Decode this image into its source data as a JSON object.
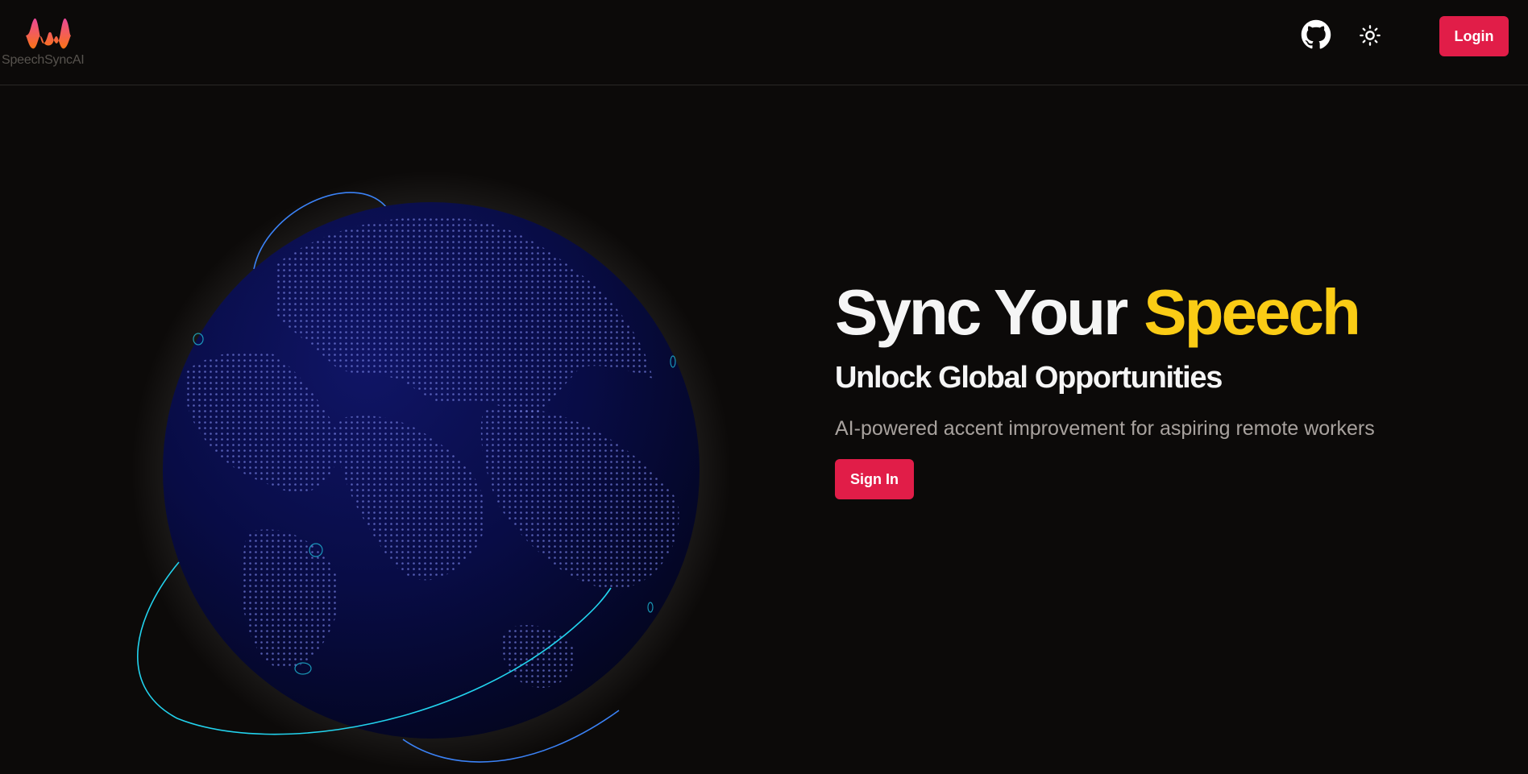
{
  "brand": {
    "name": "SpeechSyncAI",
    "logo_icon": "waveform-logo-icon",
    "gradient": [
      "#ec4899",
      "#f97316"
    ]
  },
  "header": {
    "github_icon": "github-icon",
    "theme_icon": "sun-icon",
    "login_label": "Login"
  },
  "hero": {
    "title_part1": "Sync Your",
    "title_part2": "Speech",
    "subtitle": "Unlock Global Opportunities",
    "description": "AI-powered accent improvement for aspiring remote workers",
    "cta_label": "Sign In"
  },
  "colors": {
    "background": "#0c0a09",
    "accent": "#e11d48",
    "highlight": "#facc15",
    "globe": "#0b0f4a",
    "arc": "#22d3ee"
  }
}
